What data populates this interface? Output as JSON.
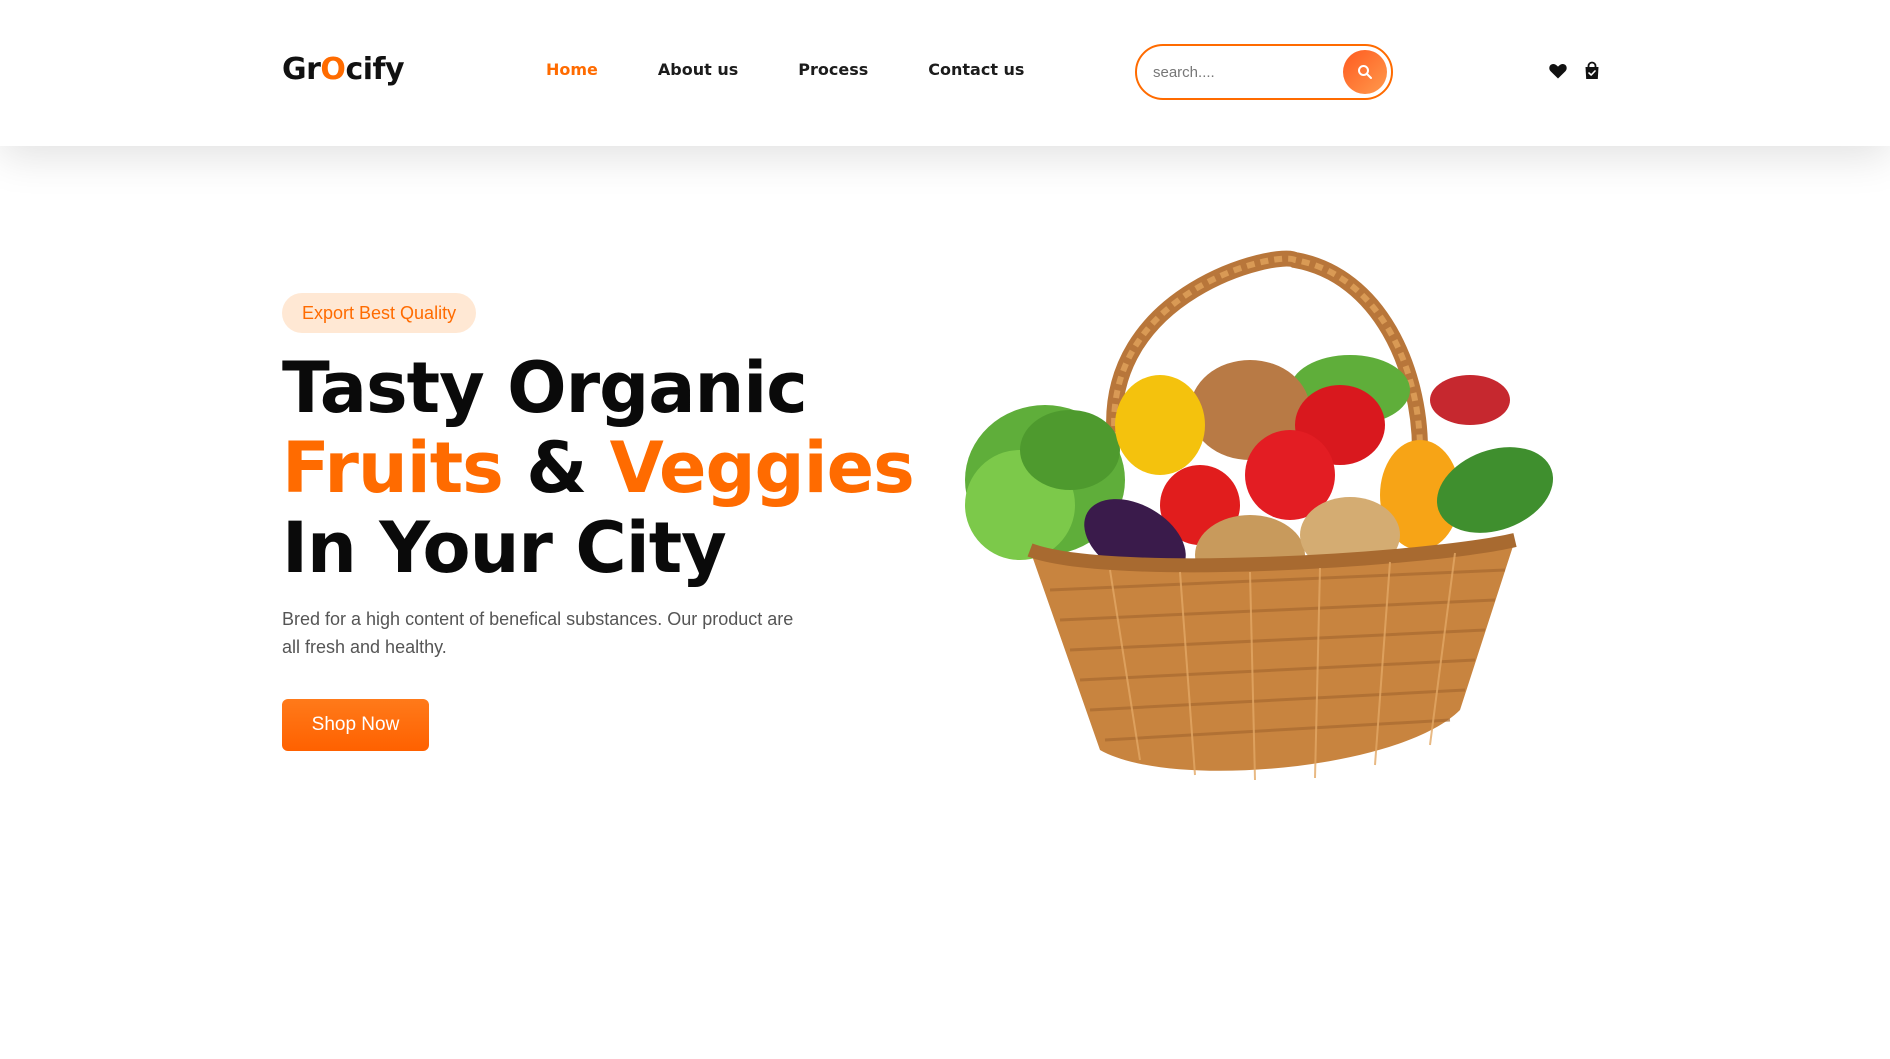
{
  "header": {
    "logo": {
      "part1": "Gr",
      "part2": "O",
      "part3": "cify"
    },
    "nav": [
      {
        "label": "Home",
        "active": true
      },
      {
        "label": "About us",
        "active": false
      },
      {
        "label": "Process",
        "active": false
      },
      {
        "label": "Contact us",
        "active": false
      }
    ],
    "search": {
      "placeholder": "search....",
      "value": "",
      "icon": "search-icon"
    },
    "icons": [
      "heart-icon",
      "shopping-bag-icon"
    ]
  },
  "hero": {
    "badge": "Export Best Quality",
    "title": {
      "line1": "Tasty Organic",
      "line2_a": "Fruits",
      "line2_b": " & ",
      "line2_c": "Veggies",
      "line3": "In Your City"
    },
    "description": "Bred for a high content of benefical substances. Our product are all fresh and healthy.",
    "cta": "Shop Now",
    "image": "vegetable-basket-image"
  },
  "colors": {
    "accent": "#ff6b00",
    "badge_bg": "#ffe8d4",
    "text_dark": "#0a0a0a",
    "text_muted": "#555555"
  }
}
